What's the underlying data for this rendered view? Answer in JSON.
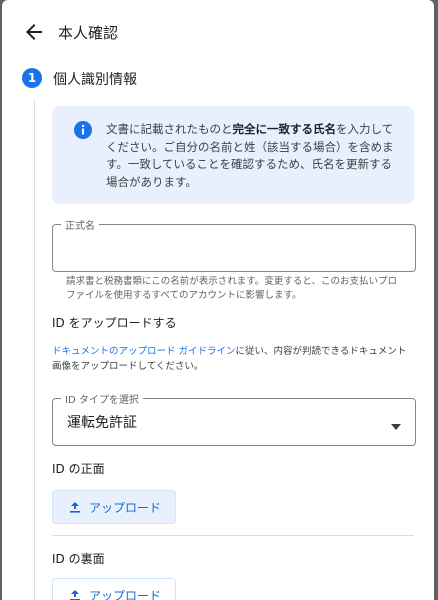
{
  "header": {
    "title": "本人確認"
  },
  "step": {
    "number": "1",
    "title": "個人識別情報"
  },
  "info": {
    "text_before": "文書に記載されたものと",
    "text_bold": "完全に一致する氏名",
    "text_after": "を入力してください。ご自分の名前と姓（該当する場合）を含めます。一致していることを確認するため、氏名を更新する場合があります。"
  },
  "legal_name": {
    "label": "正式名",
    "value": "",
    "helper": "請求書と税務書類にこの名前が表示されます。変更すると、このお支払いプロファイルを使用するすべてのアカウントに影響します。"
  },
  "id_upload": {
    "heading": "ID をアップロードする",
    "link_text": "ドキュメントのアップロード ガイドライン",
    "after_link": "に従い、内容が判読できるドキュメント画像をアップロードしてください。"
  },
  "id_type": {
    "label": "ID タイプを選択",
    "value": "運転免許証"
  },
  "front": {
    "heading": "ID の正面",
    "button": "アップロード"
  },
  "back": {
    "heading": "ID の裏面",
    "button": "アップロード"
  }
}
